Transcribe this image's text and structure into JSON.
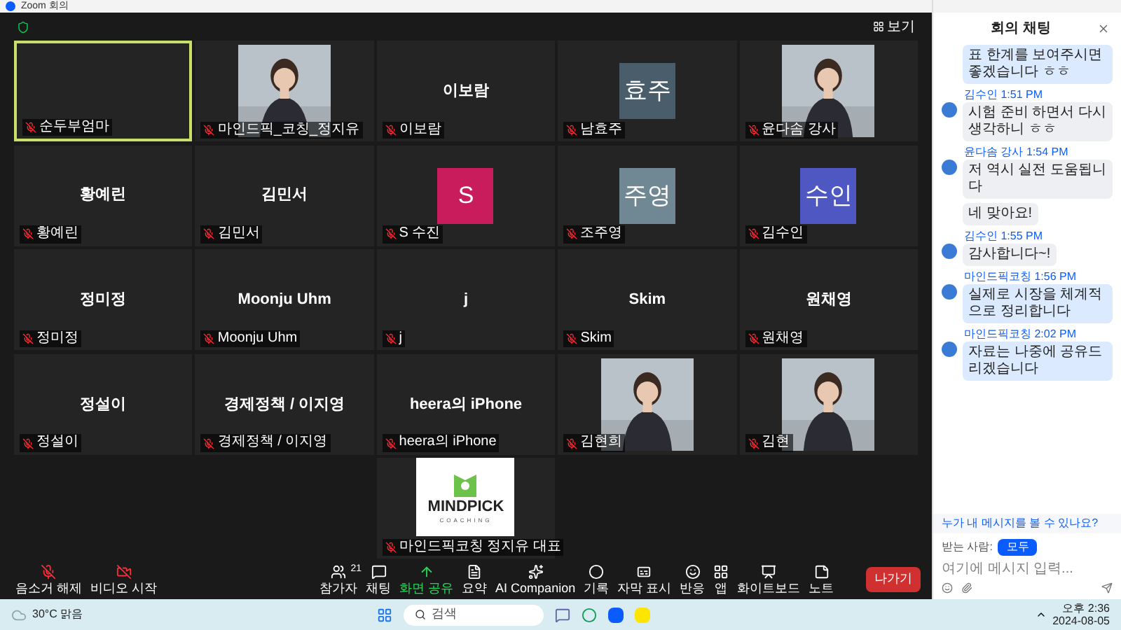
{
  "window": {
    "title": "Zoom 회의"
  },
  "top_bar": {
    "view_button": "보기"
  },
  "tiles": [
    {
      "kind": "blank",
      "tag": "순두부엄마",
      "speaking": true
    },
    {
      "tag": "마인드픽_코칭_정지유",
      "speaking": false
    },
    {
      "kind": "name",
      "name": "이보람",
      "tag": "이보람",
      "speaking": false
    },
    {
      "kind": "avatar",
      "name": "효주",
      "color": "#4a5d6b",
      "tag": "남효주",
      "speaking": false
    },
    {
      "tag": "윤다솜 강사",
      "speaking": false
    },
    {
      "kind": "name",
      "name": "황예린",
      "tag": "황예린",
      "speaking": false
    },
    {
      "kind": "name",
      "name": "김민서",
      "tag": "김민서",
      "speaking": false
    },
    {
      "kind": "avatar",
      "name": "S",
      "color": "#c81c5c",
      "tag": "S 수진",
      "speaking": false
    },
    {
      "kind": "avatar",
      "name": "주영",
      "color": "#6f8894",
      "tag": "조주영",
      "speaking": false
    },
    {
      "kind": "avatar",
      "name": "수인",
      "color": "#4f58c2",
      "tag": "김수인",
      "speaking": false
    },
    {
      "kind": "name",
      "name": "정미정",
      "tag": "정미정",
      "speaking": false
    },
    {
      "kind": "name",
      "name": "Moonju Uhm",
      "tag": "Moonju Uhm",
      "speaking": false
    },
    {
      "kind": "name",
      "name": "j",
      "tag": "j",
      "speaking": false
    },
    {
      "kind": "name",
      "name": "Skim",
      "tag": "Skim",
      "speaking": false
    },
    {
      "kind": "name",
      "name": "원채영",
      "tag": "원채영",
      "speaking": false
    },
    {
      "kind": "name",
      "name": "정설이",
      "tag": "정설이",
      "speaking": false
    },
    {
      "kind": "name",
      "name": "경제정책 / 이지영",
      "tag": "경제정책 / 이지영",
      "speaking": false
    },
    {
      "kind": "name",
      "name": "heera의 iPhone",
      "tag": "heera의 iPhone",
      "speaking": false
    },
    {
      "tag": "김현희",
      "speaking": false
    },
    {
      "tag": "김현",
      "speaking": false
    },
    {
      "kind": "logo",
      "logo_text": "MINDPICK",
      "logo_sub": "COACHING",
      "tag": "마인드픽코칭 정지유 대표",
      "speaking": false
    }
  ],
  "toolbar": [
    {
      "kind": "mic",
      "label": "음소거 해제",
      "muted": true
    },
    {
      "kind": "video",
      "label": "비디오 시작",
      "muted": true
    },
    {
      "kind": "participants",
      "label": "참가자",
      "count": "21"
    },
    {
      "kind": "chat",
      "label": "채팅"
    },
    {
      "kind": "share",
      "label": "화면 공유"
    },
    {
      "kind": "summary",
      "label": "요약"
    },
    {
      "kind": "ai",
      "label": "AI Companion"
    },
    {
      "kind": "record",
      "label": "기록"
    },
    {
      "kind": "captions",
      "label": "자막 표시"
    },
    {
      "kind": "reactions",
      "label": "반응"
    },
    {
      "kind": "apps",
      "label": "앱"
    },
    {
      "kind": "whiteboard",
      "label": "화이트보드"
    },
    {
      "kind": "notes",
      "label": "노트"
    }
  ],
  "leave_button": "나가기",
  "chat": {
    "title": "회의 채팅",
    "messages": [
      {
        "kind": "continued",
        "text": "표 한계를 보여주시면 좋겠습니다 ㅎㅎ",
        "mine": true
      },
      {
        "kind": "header",
        "sender": "김수인",
        "time": "1:51 PM",
        "text": "시험 준비 하면서 다시 생각하니 ㅎㅎ",
        "mine": false
      },
      {
        "kind": "header",
        "sender": "윤다솜 강사",
        "time": "1:54 PM",
        "text": "저 역시 실전 도움됩니다",
        "mine": false
      },
      {
        "kind": "continued",
        "text": "네 맞아요!",
        "mine": false
      },
      {
        "kind": "header",
        "sender": "김수인",
        "time": "1:55 PM",
        "text": "감사합니다~!",
        "mine": false
      },
      {
        "kind": "header",
        "sender": "마인드픽코칭",
        "time": "1:56 PM",
        "text": "실제로 시장을 체계적으로 정리합니다",
        "mine": true
      },
      {
        "kind": "header",
        "sender": "마인드픽코칭",
        "time": "2:02 PM",
        "text": "자료는 나중에 공유드리겠습니다",
        "mine": true
      }
    ],
    "notice": "누가 내 메시지를 볼 수 있나요?",
    "recipient_label": "받는 사람:",
    "recipient": "모두",
    "input": {
      "placeholder": "여기에 메시지 입력..."
    }
  },
  "taskbar": {
    "weather": "30°C",
    "weather_text": "맑음",
    "search_placeholder": "검색",
    "time": "오후 2:36",
    "date": "2024-08-05"
  }
}
